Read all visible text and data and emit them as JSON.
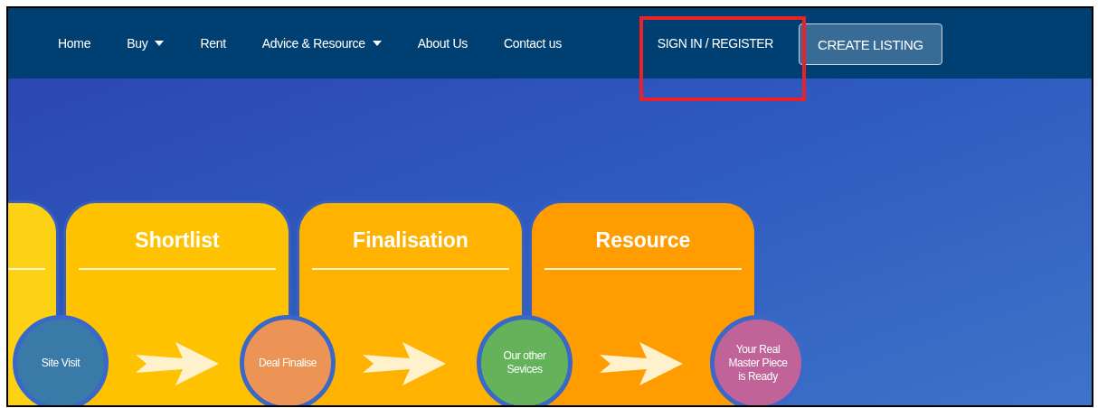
{
  "nav": {
    "items": [
      {
        "label": "Home",
        "dropdown": false
      },
      {
        "label": "Buy",
        "dropdown": true
      },
      {
        "label": "Rent",
        "dropdown": false
      },
      {
        "label": "Advice & Resource",
        "dropdown": true
      },
      {
        "label": "About Us",
        "dropdown": false
      },
      {
        "label": "Contact us",
        "dropdown": false
      }
    ],
    "sign_in": {
      "label": "SIGN IN / REGISTER",
      "highlighted": true
    },
    "create_listing": "CREATE LISTING"
  },
  "stages": [
    {
      "title": "Shortlist",
      "color": "#fec200"
    },
    {
      "title": "Finalisation",
      "color": "#ffb300"
    },
    {
      "title": "Resource",
      "color": "#ff9d00"
    }
  ],
  "steps": [
    {
      "label": "Site Visit",
      "color": "#3a7aa8"
    },
    {
      "label": "Deal Finalise",
      "color": "#ec9455"
    },
    {
      "label": "Our other Sevices",
      "color": "#64b35a"
    },
    {
      "label": "Your Real Master Piece is Ready",
      "color": "#bf6399"
    }
  ]
}
